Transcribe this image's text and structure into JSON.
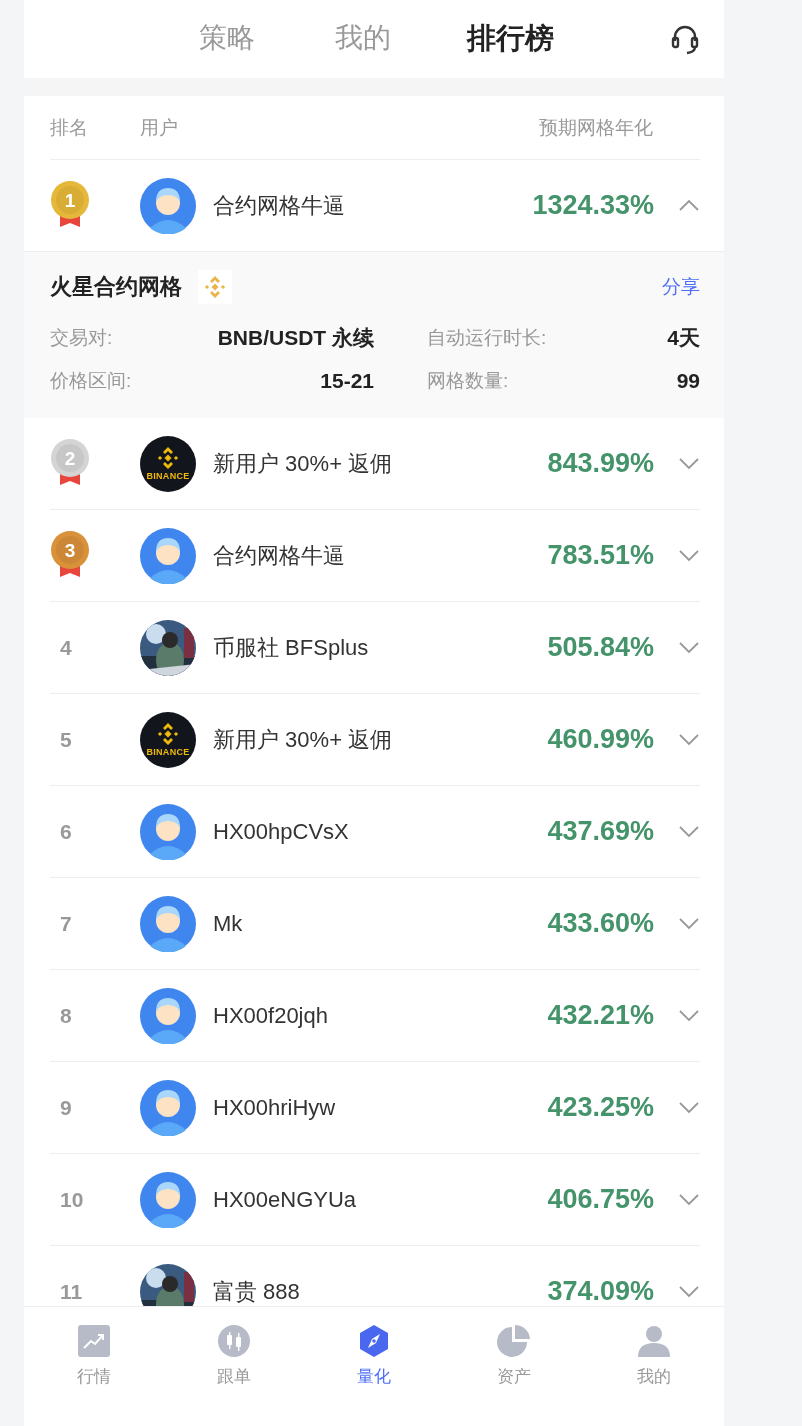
{
  "top_tabs": [
    {
      "label": "策略",
      "selected": false
    },
    {
      "label": "我的",
      "selected": false
    },
    {
      "label": "排行榜",
      "selected": true
    }
  ],
  "columns": {
    "rank": "排名",
    "user": "用户",
    "yield": "预期网格年化"
  },
  "rows": [
    {
      "rank": {
        "text": "1",
        "kind": "medal",
        "color": "#e6b83a"
      },
      "avatar": {
        "kind": "cartoon"
      },
      "name": "合约网格牛逼",
      "yield": "1324.33%",
      "expanded": true,
      "detail": {
        "title": "火星合约网格",
        "share": "分享",
        "fields": [
          {
            "label": "交易对:",
            "value": "BNB/USDT 永续"
          },
          {
            "label": "自动运行时长:",
            "value": "4天"
          },
          {
            "label": "价格区间:",
            "value": "15-21"
          },
          {
            "label": "网格数量:",
            "value": "99"
          }
        ]
      }
    },
    {
      "rank": {
        "text": "2",
        "kind": "medal",
        "color": "#d4d4d4"
      },
      "avatar": {
        "kind": "logo",
        "label": "BINANCE"
      },
      "name": "新用户 30%+ 返佣",
      "yield": "843.99%",
      "expanded": false
    },
    {
      "rank": {
        "text": "3",
        "kind": "medal",
        "color": "#d9913a"
      },
      "avatar": {
        "kind": "cartoon"
      },
      "name": "合约网格牛逼",
      "yield": "783.51%",
      "expanded": false
    },
    {
      "rank": {
        "text": "4",
        "kind": "plain"
      },
      "name": "币服社 BFSplus",
      "yield": "505.84%",
      "expanded": false
    },
    {
      "rank": {
        "text": "5",
        "kind": "plain"
      },
      "avatar": {
        "kind": "logo",
        "label": "BINANCE"
      },
      "name": "新用户 30%+ 返佣",
      "yield": "460.99%",
      "expanded": false
    },
    {
      "rank": {
        "text": "6",
        "kind": "plain"
      },
      "avatar": {
        "kind": "cartoon"
      },
      "name": "HX00hpCVsX",
      "yield": "437.69%",
      "expanded": false
    },
    {
      "rank": {
        "text": "7",
        "kind": "plain"
      },
      "avatar": {
        "kind": "cartoon"
      },
      "name": "Mk",
      "yield": "433.60%",
      "expanded": false
    },
    {
      "rank": {
        "text": "8",
        "kind": "plain"
      },
      "avatar": {
        "kind": "cartoon"
      },
      "name": "HX00f20jqh",
      "yield": "432.21%",
      "expanded": false
    },
    {
      "rank": {
        "text": "9",
        "kind": "plain"
      },
      "avatar": {
        "kind": "cartoon"
      },
      "name": "HX00hriHyw",
      "yield": "423.25%",
      "expanded": false
    },
    {
      "rank": {
        "text": "10",
        "kind": "plain"
      },
      "avatar": {
        "kind": "cartoon"
      },
      "name": "HX00eNGYUa",
      "yield": "406.75%",
      "expanded": false
    },
    {
      "rank": {
        "text": "11",
        "kind": "plain"
      },
      "name": "富贵 888",
      "yield": "374.09%",
      "expanded": false
    }
  ],
  "bottom_nav": [
    {
      "label": "行情",
      "selected": false
    },
    {
      "label": "跟单",
      "selected": false
    },
    {
      "label": "量化",
      "selected": true
    },
    {
      "label": "资产",
      "selected": false
    },
    {
      "label": "我的",
      "selected": false
    }
  ]
}
